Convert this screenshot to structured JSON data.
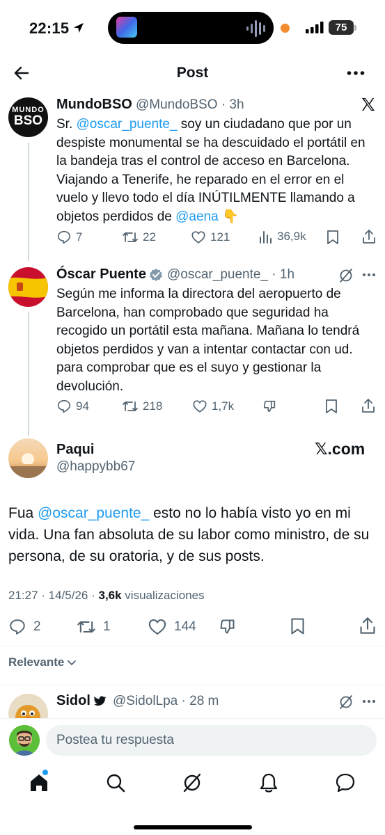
{
  "status_bar": {
    "time": "22:15",
    "battery": "75"
  },
  "header": {
    "title": "Post"
  },
  "quoted_tweet": {
    "avatar_line1": "MUNDO",
    "avatar_line2": "BSO",
    "name": "MundoBSO",
    "handle": "@MundoBSO",
    "time": "3h",
    "body_prefix": "Sr. ",
    "mention1": "@oscar_puente_",
    "body_main": "  soy un ciudadano que por un despiste monumental se ha descuidado el portátil en la bandeja tras el control de acceso en Barcelona. Viajando a Tenerife, he reparado en el error en el vuelo y llevo todo el día INÚTILMENTE llamando a objetos perdidos de ",
    "mention2": "@aena",
    "emoji": "👇",
    "replies": "7",
    "retweets": "22",
    "likes": "121",
    "views": "36,9k"
  },
  "reply_tweet": {
    "name": "Óscar Puente",
    "handle": "@oscar_puente_",
    "time": "1h",
    "body": "Según me informa la directora del aeropuerto de Barcelona, han comprobado que seguridad ha recogido un portátil esta mañana. Mañana lo tendrá objetos perdidos y van a intentar contactar con ud. para comprobar que es el suyo y gestionar la devolución.",
    "replies": "94",
    "retweets": "218",
    "likes": "1,7k"
  },
  "main_tweet": {
    "name": "Paqui",
    "handle": "@happybb67",
    "source": "𝕏.com",
    "body_prefix": "Fua ",
    "mention": "@oscar_puente_",
    "body_main": "  esto no lo había visto yo en mi vida. Una fan absoluta de su labor como ministro, de su persona, de su oratoria, y de sus posts.",
    "timestamp": "21:27 · 14/5/26 · ",
    "views_count": "3,6k",
    "views_label": " visualizaciones",
    "replies": "2",
    "retweets": "1",
    "likes": "144"
  },
  "sort": {
    "label": "Relevante"
  },
  "next_reply": {
    "name": "Sidol",
    "handle": "@SidolLpa",
    "time": "28 m"
  },
  "composer": {
    "placeholder": "Postea tu respuesta"
  },
  "colors": {
    "accent": "#1d9bf0",
    "muted": "#536471",
    "text": "#0f1419"
  },
  "icons": [
    "back-arrow-icon",
    "more-icon",
    "x-logo-icon",
    "reply-icon",
    "retweet-icon",
    "like-icon",
    "views-icon",
    "bookmark-icon",
    "share-icon",
    "grok-icon",
    "verified-icon",
    "downvote-icon",
    "home-icon",
    "search-icon",
    "notifications-icon",
    "messages-icon"
  ]
}
